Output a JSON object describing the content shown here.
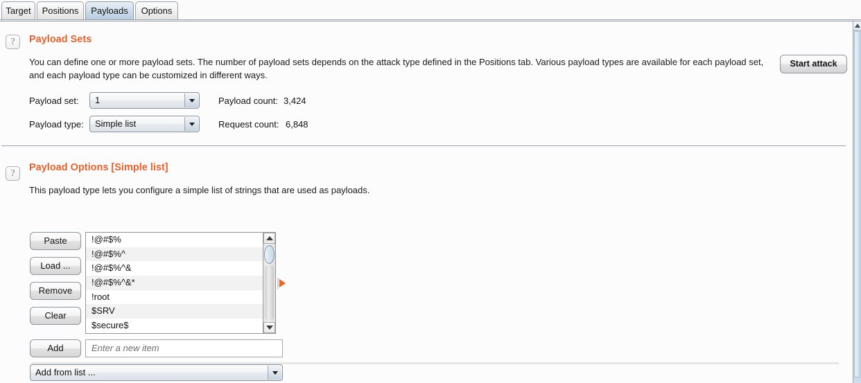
{
  "tabs": [
    {
      "label": "Target",
      "active": false
    },
    {
      "label": "Positions",
      "active": false
    },
    {
      "label": "Payloads",
      "active": true
    },
    {
      "label": "Options",
      "active": false
    }
  ],
  "toolbar": {
    "start_attack_label": "Start attack"
  },
  "payload_sets": {
    "help_glyph": "?",
    "title": "Payload Sets",
    "description_line1": "You can define one or more payload sets. The number of payload sets depends on the attack type defined in the Positions tab. Various payload types are available for each payload set,",
    "description_line2": "and each payload type can be customized in different ways.",
    "payload_set_label": "Payload set:",
    "payload_set_value": "1",
    "payload_type_label": "Payload type:",
    "payload_type_value": "Simple list",
    "payload_count_label": "Payload count:",
    "payload_count_value": "3,424",
    "request_count_label": "Request count:",
    "request_count_value": "6,848"
  },
  "payload_options": {
    "help_glyph": "?",
    "title": "Payload Options [Simple list]",
    "description": "This payload type lets you configure a simple list of strings that are used as payloads.",
    "buttons": {
      "paste": "Paste",
      "load": "Load ...",
      "remove": "Remove",
      "clear": "Clear",
      "add": "Add"
    },
    "items": [
      "!@#$%",
      "!@#$%^",
      "!@#$%^&",
      "!@#$%^&*",
      "!root",
      "$SRV",
      "$secure$"
    ],
    "new_item_placeholder": "Enter a new item",
    "add_from_list_value": "Add from list ..."
  },
  "colors": {
    "accent_orange": "#e8622c",
    "splitter_orange": "#f4631e",
    "active_tab_blue": "#b6cce0",
    "scrollbar_blue": "#cdddee"
  }
}
